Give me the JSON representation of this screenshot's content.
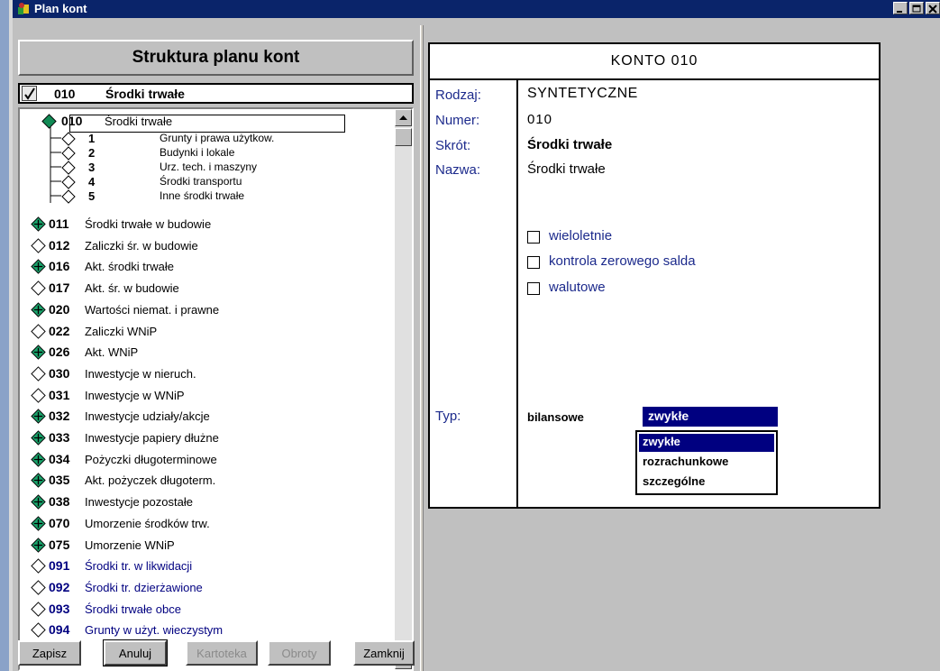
{
  "window": {
    "title": "Plan kont"
  },
  "left": {
    "header": "Struktura planu kont",
    "selected": {
      "num": "010",
      "name": "Środki trwałe"
    },
    "root": {
      "num": "010",
      "name": "Środki trwałe"
    },
    "subitems": [
      {
        "num": "1",
        "name": "Grunty i prawa użytkow."
      },
      {
        "num": "2",
        "name": "Budynki i lokale"
      },
      {
        "num": "3",
        "name": "Urz. tech. i maszyny"
      },
      {
        "num": "4",
        "name": "Środki transportu"
      },
      {
        "num": "5",
        "name": "Inne środki trwałe"
      }
    ],
    "items": [
      {
        "num": "011",
        "name": "Środki trwałe w budowie",
        "icon": "plus-diamond-icon"
      },
      {
        "num": "012",
        "name": "Zaliczki śr. w budowie",
        "icon": "empty-diamond-icon"
      },
      {
        "num": "016",
        "name": "Akt. środki trwałe",
        "icon": "plus-diamond-icon"
      },
      {
        "num": "017",
        "name": "Akt. śr. w budowie",
        "icon": "empty-diamond-icon"
      },
      {
        "num": "020",
        "name": "Wartości niemat. i prawne",
        "icon": "plus-diamond-icon"
      },
      {
        "num": "022",
        "name": "Zaliczki WNiP",
        "icon": "empty-diamond-icon"
      },
      {
        "num": "026",
        "name": "Akt. WNiP",
        "icon": "plus-diamond-icon"
      },
      {
        "num": "030",
        "name": "Inwestycje w nieruch.",
        "icon": "empty-diamond-icon"
      },
      {
        "num": "031",
        "name": "Inwestycje w WNiP",
        "icon": "empty-diamond-icon"
      },
      {
        "num": "032",
        "name": "Inwestycje udziały/akcje",
        "icon": "plus-diamond-icon"
      },
      {
        "num": "033",
        "name": "Inwestycje papiery dłużne",
        "icon": "plus-diamond-icon"
      },
      {
        "num": "034",
        "name": "Pożyczki długoterminowe",
        "icon": "plus-diamond-icon"
      },
      {
        "num": "035",
        "name": "Akt. pożyczek długoterm.",
        "icon": "plus-diamond-icon"
      },
      {
        "num": "038",
        "name": "Inwestycje pozostałe",
        "icon": "plus-diamond-icon"
      },
      {
        "num": "070",
        "name": "Umorzenie środków trw.",
        "icon": "plus-diamond-icon"
      },
      {
        "num": "075",
        "name": "Umorzenie WNiP",
        "icon": "plus-diamond-icon"
      },
      {
        "num": "091",
        "name": "Środki tr. w likwidacji",
        "icon": "empty-diamond-icon",
        "color": "blue"
      },
      {
        "num": "092",
        "name": "Środki tr. dzierżawione",
        "icon": "empty-diamond-icon",
        "color": "blue"
      },
      {
        "num": "093",
        "name": "Środki trwałe obce",
        "icon": "empty-diamond-icon",
        "color": "blue"
      },
      {
        "num": "094",
        "name": "Grunty w użyt. wieczystym",
        "icon": "empty-diamond-icon",
        "color": "blue"
      }
    ]
  },
  "buttons": {
    "save": "Zapisz",
    "cancel": "Anuluj",
    "card": "Kartoteka",
    "turnover": "Obroty",
    "close": "Zamknij"
  },
  "card": {
    "title": "KONTO 010",
    "labels": {
      "rodzaj": "Rodzaj:",
      "numer": "Numer:",
      "skrot": "Skrót:",
      "nazwa": "Nazwa:",
      "typ": "Typ:"
    },
    "rodzaj": "SYNTETYCZNE",
    "numer": "010",
    "skrot": "Środki trwałe",
    "nazwa": "Środki trwałe",
    "checkboxes": [
      "wieloletnie",
      "kontrola zerowego salda",
      "walutowe"
    ],
    "typ_kind": "bilansowe",
    "typ_selected": "zwykłe",
    "typ_options": [
      "zwykłe",
      "rozrachunkowe",
      "szczególne"
    ]
  },
  "colors": {
    "title_bg": "#0a246a",
    "label_blue": "#1c2a8c",
    "selection": "#000080",
    "plus_icon": "#1aa36b"
  }
}
